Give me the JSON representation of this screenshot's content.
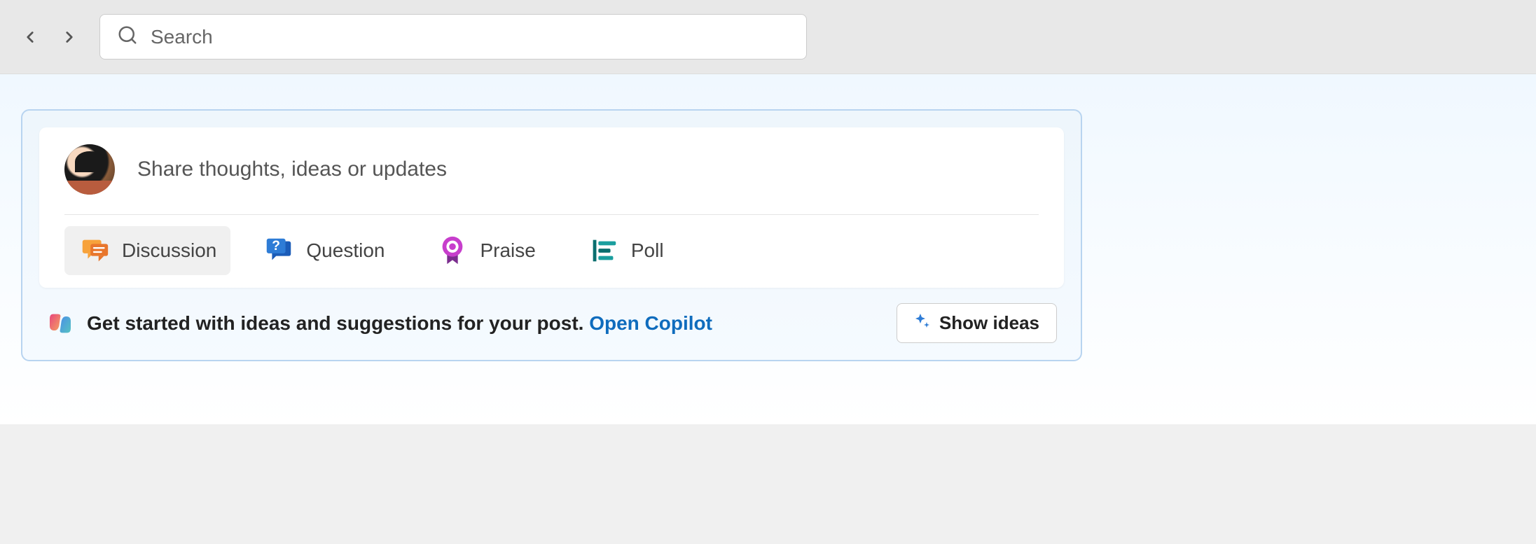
{
  "header": {
    "search_placeholder": "Search"
  },
  "compose": {
    "placeholder": "Share thoughts, ideas or updates",
    "types": {
      "discussion": "Discussion",
      "question": "Question",
      "praise": "Praise",
      "poll": "Poll"
    }
  },
  "copilot": {
    "text": "Get started with ideas and suggestions for your post. ",
    "link": "Open Copilot",
    "button": "Show ideas"
  }
}
